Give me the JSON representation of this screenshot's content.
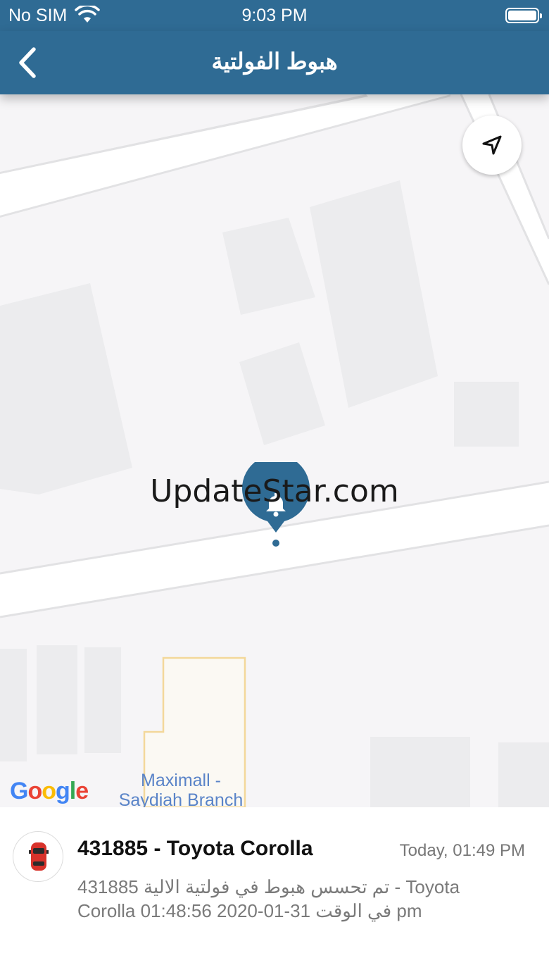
{
  "status_bar": {
    "carrier": "No SIM",
    "time": "9:03 PM"
  },
  "nav": {
    "title": "هبوط الفولتية"
  },
  "map": {
    "poi_label": "Maximall - Saydiah Branch",
    "provider": "Google",
    "provider_colors": [
      "#4285F4",
      "#EA4335",
      "#FBBC05",
      "#4285F4",
      "#34A853",
      "#EA4335"
    ]
  },
  "watermark": "UpdateStar.com",
  "alert": {
    "title": "431885 - Toyota Corolla",
    "time": "Today, 01:49 PM",
    "message_line1": "تم تحسس هبوط في فولتية الالية 431885 - Toyota",
    "message_line2": "Corolla في الوقت 31-01-2020 01:48:56 pm"
  },
  "colors": {
    "brand": "#2f6b94",
    "map_bg": "#f6f5f7",
    "accent_red": "#d8322b"
  }
}
